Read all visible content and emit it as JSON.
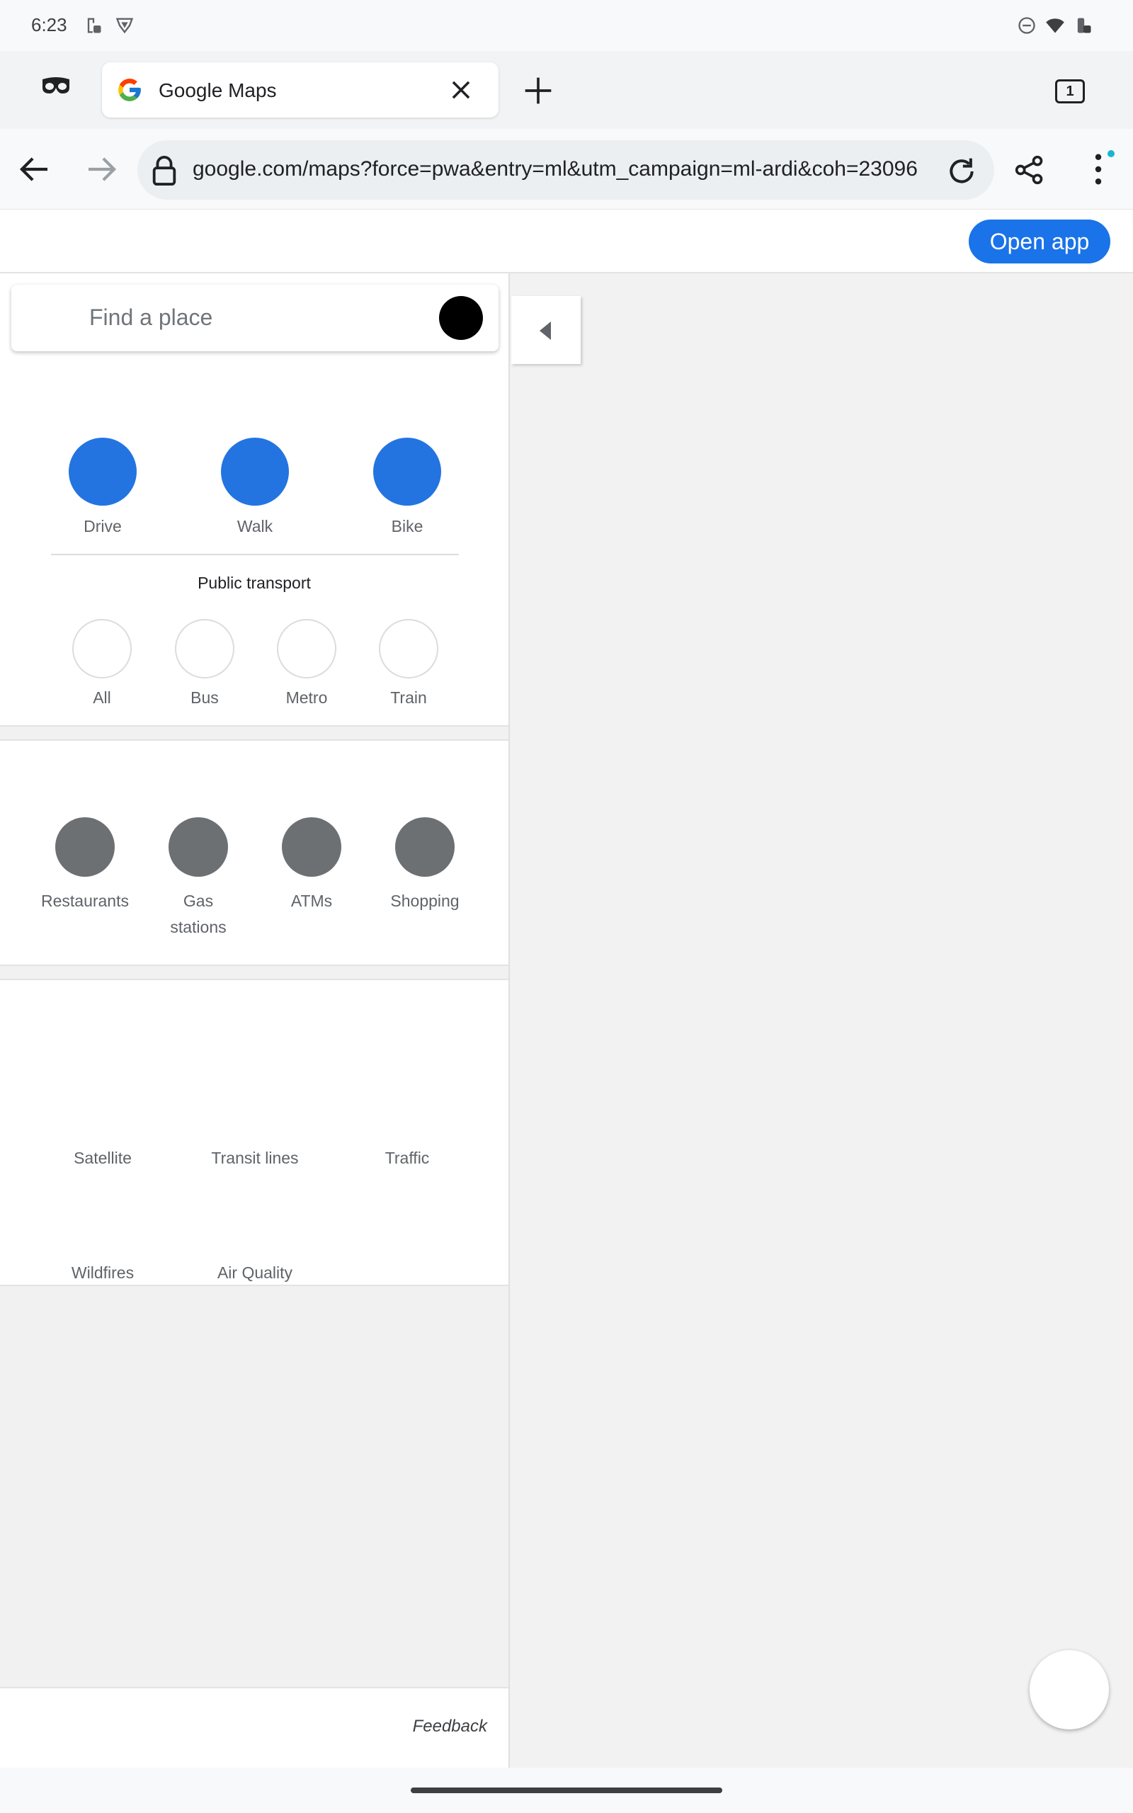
{
  "status_bar": {
    "time": "6:23"
  },
  "browser": {
    "tab_title": "Google Maps",
    "tab_count": "1",
    "url": "google.com/maps?force=pwa&entry=ml&utm_campaign=ml-ardi&coh=23096",
    "open_app_label": "Open app"
  },
  "search": {
    "placeholder": "Find a place"
  },
  "modes": [
    {
      "label": "Drive"
    },
    {
      "label": "Walk"
    },
    {
      "label": "Bike"
    }
  ],
  "public_transport": {
    "heading": "Public transport",
    "options": [
      {
        "label": "All"
      },
      {
        "label": "Bus"
      },
      {
        "label": "Metro"
      },
      {
        "label": "Train"
      }
    ]
  },
  "nearby": [
    {
      "label": "Restaurants"
    },
    {
      "label": "Gas stations"
    },
    {
      "label": "ATMs"
    },
    {
      "label": "Shopping"
    }
  ],
  "layers": [
    {
      "label": "Satellite"
    },
    {
      "label": "Transit lines"
    },
    {
      "label": "Traffic"
    },
    {
      "label": "Wildfires"
    },
    {
      "label": "Air Quality"
    }
  ],
  "footer": {
    "feedback": "Feedback"
  },
  "colors": {
    "accent": "#1a73e8",
    "mode_circle": "#2374e1",
    "nearby_circle": "#6d7073"
  }
}
